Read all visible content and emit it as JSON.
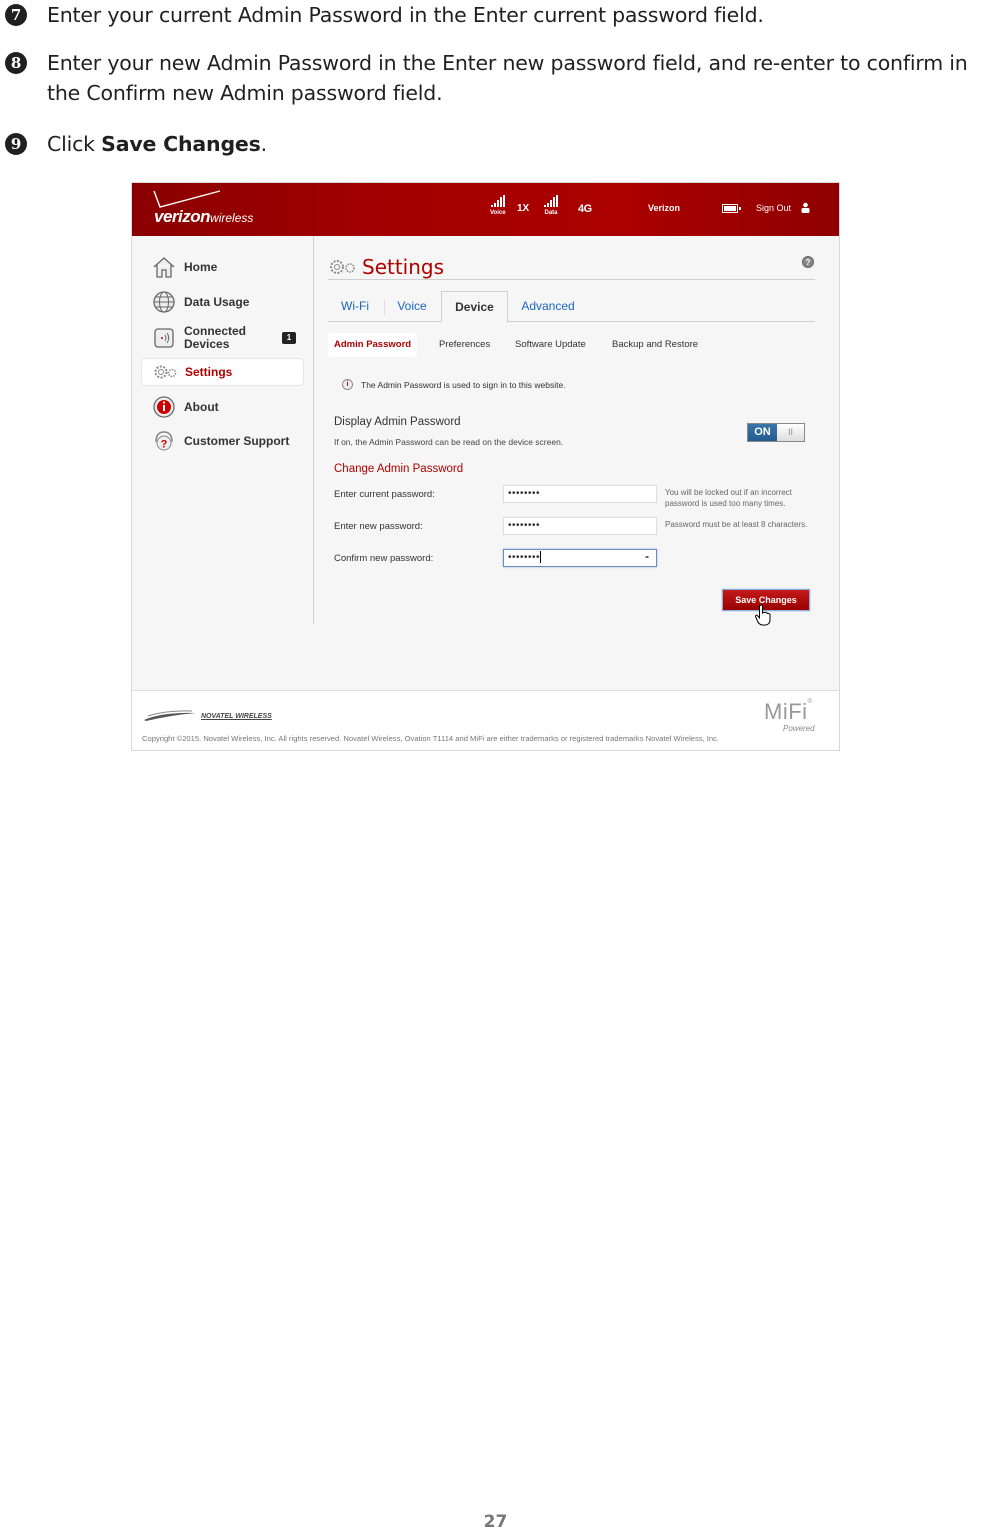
{
  "steps": [
    {
      "number": "7",
      "text": "Enter your current Admin Password in the  Enter current password field."
    },
    {
      "number": "8",
      "text": "Enter your new Admin Password in the Enter new password field, and re-enter to confirm in the Confirm new Admin password field."
    },
    {
      "number": "9",
      "prefix": "Click ",
      "bold": "Save Changes",
      "suffix": "."
    }
  ],
  "screenshot": {
    "header": {
      "brand_bold": "verizon",
      "brand_light": "wireless",
      "voice_label": "Voice",
      "network_1x": "1X",
      "data_label": "Data",
      "network_4g": "4G",
      "carrier": "Verizon",
      "sign_out": "Sign Out"
    },
    "sidebar": {
      "items": [
        {
          "label": "Home",
          "icon": "home-icon"
        },
        {
          "label": "Data Usage",
          "icon": "globe-icon"
        },
        {
          "label": "Connected Devices",
          "line1": "Connected",
          "line2": "Devices",
          "icon": "device-icon",
          "badge": "1"
        },
        {
          "label": "Settings",
          "icon": "gears-icon",
          "active": true
        },
        {
          "label": "About",
          "icon": "info-icon"
        },
        {
          "label": "Customer Support",
          "icon": "support-icon"
        }
      ]
    },
    "main": {
      "title": "Settings",
      "help": "?",
      "tabs": [
        "Wi-Fi",
        "Voice",
        "Device",
        "Advanced"
      ],
      "active_tab": "Device",
      "subtabs": [
        "Admin Password",
        "Preferences",
        "Software Update",
        "Backup and Restore"
      ],
      "active_subtab": "Admin Password",
      "info": "The Admin Password is used to sign in to this website.",
      "display_title": "Display Admin Password",
      "display_desc": "If on, the Admin Password can be read on the device screen.",
      "toggle_on": "ON",
      "toggle_off": "II",
      "change_title": "Change Admin Password",
      "fields": [
        {
          "label": "Enter current password:",
          "value": "••••••••",
          "hint": "You will be locked out if an incorrect password is used too many times."
        },
        {
          "label": "Enter new password:",
          "value": "••••••••",
          "hint": "Password must be at least 8 characters."
        },
        {
          "label": "Confirm new password:",
          "value": "••••••••",
          "hint": ""
        }
      ],
      "save_button": "Save Changes"
    },
    "footer": {
      "novatel": "NOVATEL WIRELESS",
      "copyright": "Copyright ©2015. Novatel Wireless, Inc. All rights reserved. Novatel Wireless, Ovation T1114 and MiFi are either trademarks or registered trademarks Novatel Wireless, Inc.",
      "mifi": "MiFi",
      "mifi_reg": "®",
      "powered": "Powered"
    }
  },
  "page_number": "27",
  "colors": {
    "brand_red": "#b00000",
    "link_blue": "#1a66c2",
    "toggle_blue": "#235d8f"
  }
}
